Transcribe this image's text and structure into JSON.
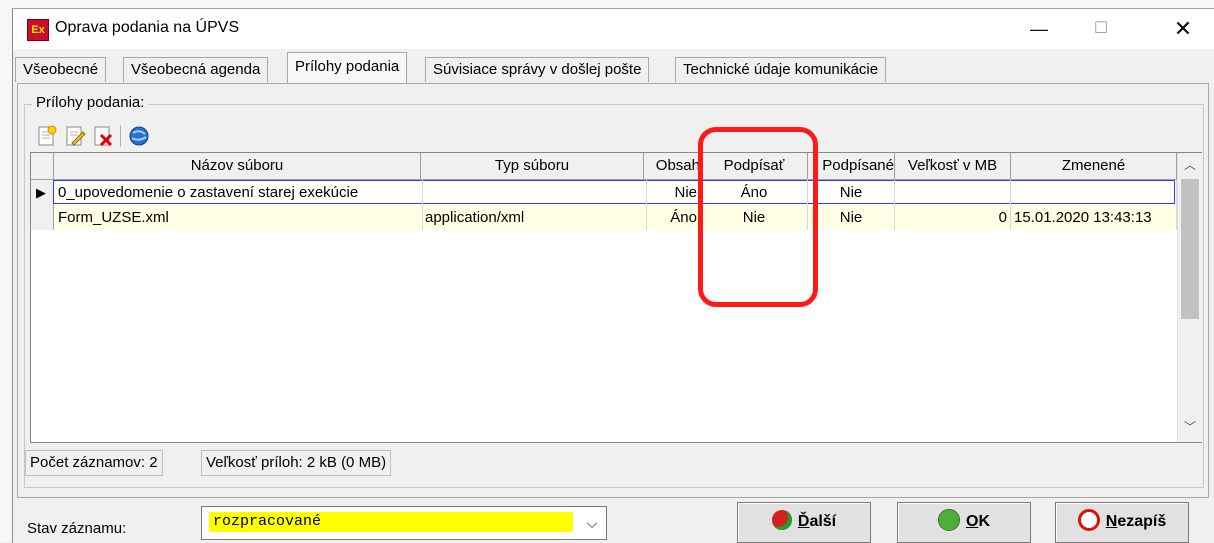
{
  "window": {
    "app_icon_text": "Ex",
    "title": "Oprava podania na ÚPVS",
    "minimize_glyph": "—",
    "maximize_glyph": "☐",
    "close_glyph": "✕"
  },
  "tabs": [
    {
      "label": "Všeobecné",
      "active": false
    },
    {
      "label": "Všeobecná agenda",
      "active": false
    },
    {
      "label": "Prílohy podania",
      "active": true
    },
    {
      "label": "Súvisiace správy v došlej pošte",
      "active": false
    },
    {
      "label": "Technické údaje komunikácie",
      "active": false
    }
  ],
  "attachments": {
    "group_label": "Prílohy podania:",
    "toolbar_icons": [
      "new-document-icon",
      "edit-document-icon",
      "delete-document-icon",
      "refresh-globe-icon"
    ],
    "columns": [
      "Názov súboru",
      "Typ súboru",
      "Obsah",
      "Podpísať",
      "Podpísané",
      "Veľkosť v MB",
      "Zmenené"
    ],
    "rows": [
      {
        "name": "0_upovedomenie o zastavení starej exekúcie",
        "type": "",
        "content": "Nie",
        "sign": "Áno",
        "signed": "Nie",
        "size": "",
        "changed": ""
      },
      {
        "name": "Form_UZSE.xml",
        "type": "application/xml",
        "content": "Áno",
        "sign": "Nie",
        "signed": "Nie",
        "size": "0",
        "changed": "15.01.2020 13:43:13"
      }
    ],
    "current_row_indicator": "▶",
    "annotation_color": "#ff1a1a"
  },
  "status": {
    "record_count": "Počet záznamov: 2",
    "attachments_size": "Veľkosť príloh: 2 kB (0 MB)"
  },
  "record_state": {
    "label": "Stav záznamu:",
    "value": "rozpracované",
    "highlight_color": "#ffff00"
  },
  "buttons": {
    "next": {
      "label_u": "Ď",
      "label_rest": "alší"
    },
    "ok": {
      "label_u": "O",
      "label_rest": "K"
    },
    "discard": {
      "label_u": "N",
      "label_rest": "ezapíš"
    }
  }
}
